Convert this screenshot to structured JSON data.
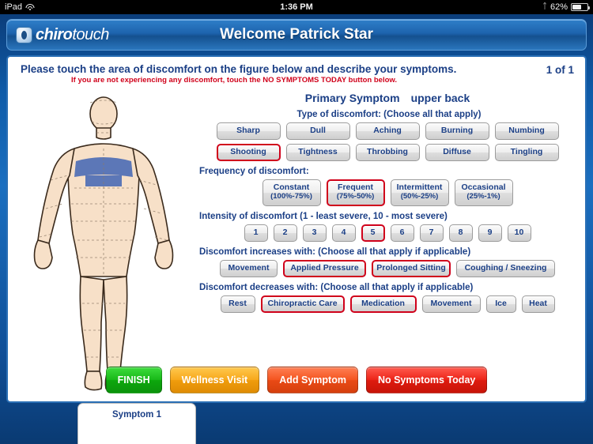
{
  "status_bar": {
    "device": "iPad",
    "wifi_icon": "wifi-icon",
    "time": "1:36 PM",
    "bluetooth_icon": "bluetooth-icon",
    "battery_text": "62%",
    "battery_icon": "battery-icon"
  },
  "titlebar": {
    "logo_icon": "chirotouch-logo-icon",
    "brand_light": "chiro",
    "brand_bold": "touch",
    "welcome": "Welcome Patrick Star"
  },
  "panel": {
    "instruction": "Please touch the area of discomfort on the figure below and describe your symptoms.",
    "sub_instruction": "If you are not experiencing any discomfort, touch the NO SYMPTOMS TODAY button below.",
    "page_indicator": "1 of 1",
    "primary_symptom_label": "Primary Symptom",
    "primary_symptom_location": "upper back",
    "body_figure_icon": "human-body-front-figure",
    "selected_region_label": "upper back"
  },
  "sections": {
    "type": {
      "title": "Type of discomfort:  (Choose all that apply)",
      "row1": [
        {
          "label": "Sharp",
          "selected": false
        },
        {
          "label": "Dull",
          "selected": false
        },
        {
          "label": "Aching",
          "selected": false
        },
        {
          "label": "Burning",
          "selected": false
        },
        {
          "label": "Numbing",
          "selected": false
        }
      ],
      "row2": [
        {
          "label": "Shooting",
          "selected": true
        },
        {
          "label": "Tightness",
          "selected": false
        },
        {
          "label": "Throbbing",
          "selected": false
        },
        {
          "label": "Diffuse",
          "selected": false
        },
        {
          "label": "Tingling",
          "selected": false
        }
      ]
    },
    "frequency": {
      "title": "Frequency of discomfort:",
      "options": [
        {
          "label": "Constant",
          "sub": "(100%-75%)",
          "selected": false
        },
        {
          "label": "Frequent",
          "sub": "(75%-50%)",
          "selected": true
        },
        {
          "label": "Intermittent",
          "sub": "(50%-25%)",
          "selected": false
        },
        {
          "label": "Occasional",
          "sub": "(25%-1%)",
          "selected": false
        }
      ]
    },
    "intensity": {
      "title": "Intensity of discomfort (1 - least severe, 10 - most severe)",
      "options": [
        {
          "label": "1",
          "selected": false
        },
        {
          "label": "2",
          "selected": false
        },
        {
          "label": "3",
          "selected": false
        },
        {
          "label": "4",
          "selected": false
        },
        {
          "label": "5",
          "selected": true
        },
        {
          "label": "6",
          "selected": false
        },
        {
          "label": "7",
          "selected": false
        },
        {
          "label": "8",
          "selected": false
        },
        {
          "label": "9",
          "selected": false
        },
        {
          "label": "10",
          "selected": false
        }
      ]
    },
    "increases": {
      "title": "Discomfort increases with: (Choose all that apply if applicable)",
      "options": [
        {
          "label": "Movement",
          "selected": false
        },
        {
          "label": "Applied Pressure",
          "selected": true
        },
        {
          "label": "Prolonged Sitting",
          "selected": true
        },
        {
          "label": "Coughing / Sneezing",
          "selected": false
        }
      ]
    },
    "decreases": {
      "title": "Discomfort decreases with: (Choose all that apply if applicable)",
      "options": [
        {
          "label": "Rest",
          "selected": false
        },
        {
          "label": "Chiropractic Care",
          "selected": true
        },
        {
          "label": "Medication",
          "selected": true
        },
        {
          "label": "Movement",
          "selected": false
        },
        {
          "label": "Ice",
          "selected": false
        },
        {
          "label": "Heat",
          "selected": false
        }
      ]
    }
  },
  "actions": {
    "finish": "FINISH",
    "wellness": "Wellness Visit",
    "add_symptom": "Add Symptom",
    "no_symptoms": "No Symptoms Today"
  },
  "bottom_tab": {
    "label": "Symptom 1"
  },
  "colors": {
    "accent_blue": "#1b3f86",
    "selection_red": "#d0021b",
    "finish_green": "#18b818",
    "wellness_orange": "#f7a81b",
    "add_orange": "#f4541f",
    "nosym_red": "#ec2418",
    "body_skin": "#f7e0c8",
    "region_highlight": "#4a6bb5"
  }
}
